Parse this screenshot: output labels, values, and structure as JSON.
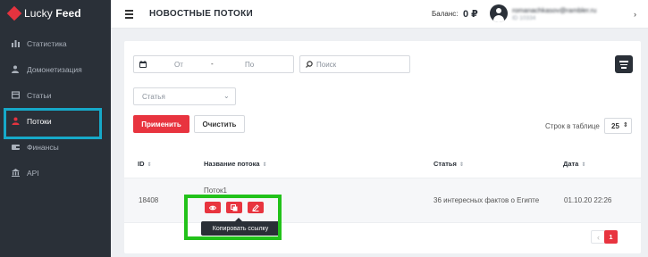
{
  "brand": {
    "name_light": "Lucky",
    "name_bold": "Feed",
    "accent": "#e5333f",
    "sidebar_bg": "#2a3038"
  },
  "sidebar": {
    "items": [
      {
        "label": "Статистика",
        "icon": "bar-chart-icon",
        "active": false
      },
      {
        "label": "Домонетизация",
        "icon": "user-money-icon",
        "active": false
      },
      {
        "label": "Статьи",
        "icon": "article-icon",
        "active": false
      },
      {
        "label": "Потоки",
        "icon": "users-stream-icon",
        "active": true
      },
      {
        "label": "Финансы",
        "icon": "finance-icon",
        "active": false
      },
      {
        "label": "API",
        "icon": "api-icon",
        "active": false
      }
    ]
  },
  "header": {
    "title": "НОВОСТНЫЕ ПОТОКИ",
    "balance_label": "Баланс:",
    "balance_value": "0 ₽",
    "user_email": "romanachkasov@rambler.ru",
    "user_id": "ID 10334",
    "chevron": "›"
  },
  "filters": {
    "date_from_placeholder": "От",
    "date_separator": "-",
    "date_to_placeholder": "По",
    "search_placeholder": "Поиск",
    "article_placeholder": "Статья",
    "apply_label": "Применить",
    "clear_label": "Очистить",
    "rows_label": "Строк в таблице",
    "rows_value": "25"
  },
  "table": {
    "columns": [
      "ID",
      "Название потока",
      "Статья",
      "Дата"
    ],
    "rows": [
      {
        "id": "18408",
        "name": "Поток1",
        "article": "36 интересных фактов о Египте",
        "date": "01.10.20 22:26"
      }
    ]
  },
  "tooltip": {
    "text": "Копировать ссылку"
  },
  "pagination": {
    "prev": "‹",
    "current": "1"
  }
}
